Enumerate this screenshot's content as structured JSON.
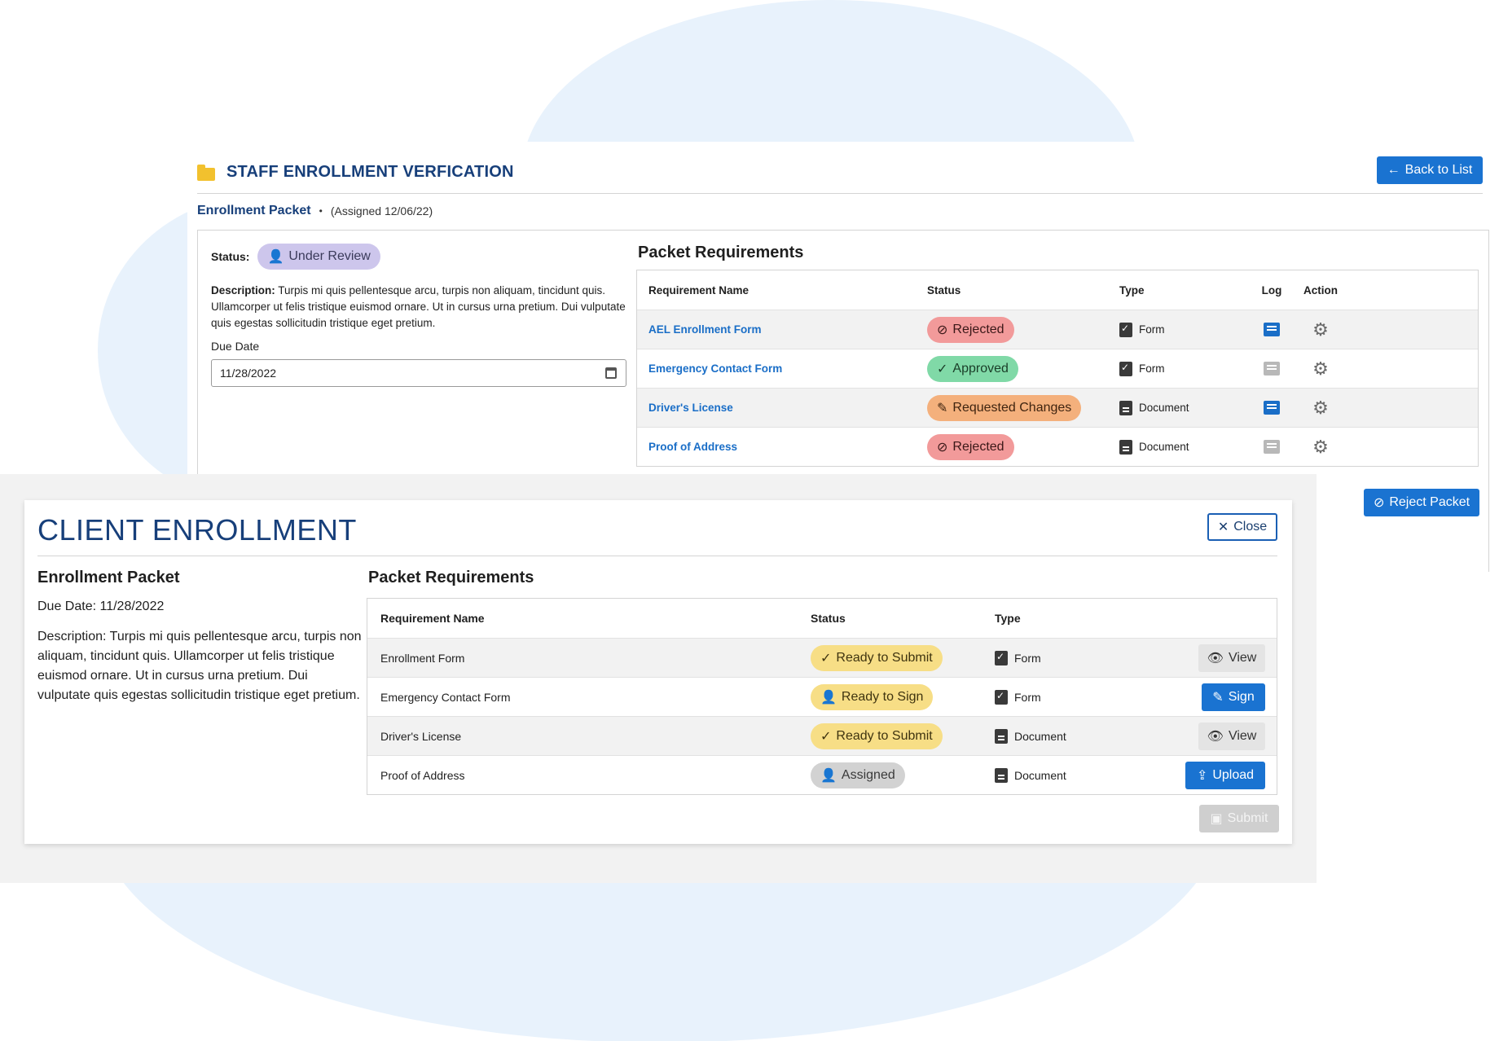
{
  "staff": {
    "title": "STAFF ENROLLMENT VERFICATION",
    "back_label": "Back to List",
    "packet_name": "Enrollment Packet",
    "assigned": "(Assigned 12/06/22)",
    "status_label": "Status:",
    "status_value": "Under Review",
    "description_label": "Description:",
    "description": "Turpis mi quis pellentesque arcu, turpis non aliquam, tincidunt quis. Ullamcorper ut felis tristique euismod ornare. Ut in cursus urna pretium. Dui vulputate quis egestas sollicitudin tristique eget pretium.",
    "due_label": "Due Date",
    "due_value": "11/28/2022",
    "requirements_title": "Packet Requirements",
    "headers": [
      "Requirement Name",
      "Status",
      "Type",
      "Log",
      "Action"
    ],
    "rows": [
      {
        "name": "AEL Enrollment Form",
        "status": "Rejected",
        "type": "Form"
      },
      {
        "name": "Emergency Contact Form",
        "status": "Approved",
        "type": "Form"
      },
      {
        "name": "Driver's License",
        "status": "Requested Changes",
        "type": "Document"
      },
      {
        "name": "Proof of Address",
        "status": "Rejected",
        "type": "Document"
      }
    ],
    "reject_label": "Reject Packet"
  },
  "client": {
    "title": "CLIENT ENROLLMENT",
    "close_label": "Close",
    "packet_name": "Enrollment Packet",
    "due": "Due Date: 11/28/2022",
    "description": "Description: Turpis mi quis pellentesque arcu, turpis non aliquam, tincidunt quis. Ullamcorper ut felis tristique euismod ornare. Ut in cursus urna pretium. Dui vulputate quis egestas sollicitudin tristique eget pretium.",
    "requirements_title": "Packet Requirements",
    "headers": [
      "Requirement Name",
      "Status",
      "Type"
    ],
    "rows": [
      {
        "name": "Enrollment Form",
        "status": "Ready to Submit",
        "type": "Form",
        "action": "View"
      },
      {
        "name": "Emergency Contact Form",
        "status": "Ready to Sign",
        "type": "Form",
        "action": "Sign"
      },
      {
        "name": "Driver's License",
        "status": "Ready to Submit",
        "type": "Document",
        "action": "View"
      },
      {
        "name": "Proof of Address",
        "status": "Assigned",
        "type": "Document",
        "action": "Upload"
      }
    ],
    "submit_label": "Submit"
  }
}
